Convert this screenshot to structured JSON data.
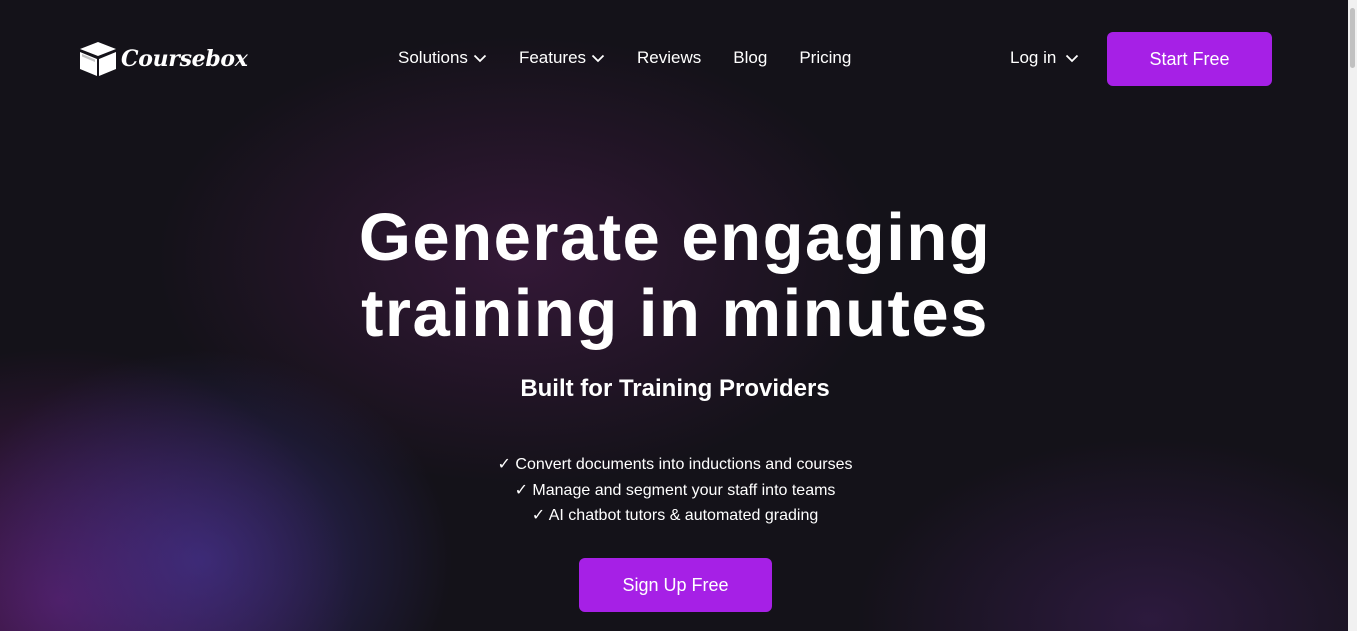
{
  "header": {
    "logo_text": "Coursebox",
    "nav": [
      {
        "label": "Solutions",
        "has_dropdown": true
      },
      {
        "label": "Features",
        "has_dropdown": true
      },
      {
        "label": "Reviews",
        "has_dropdown": false
      },
      {
        "label": "Blog",
        "has_dropdown": false
      },
      {
        "label": "Pricing",
        "has_dropdown": false
      }
    ],
    "login_label": "Log in",
    "start_button_label": "Start Free"
  },
  "hero": {
    "headline_line1": "Generate engaging",
    "headline_line2": "training in minutes",
    "subheadline": "Built for Training Providers",
    "features": [
      "✓ Convert documents into inductions and courses",
      "✓ Manage and segment your staff into teams",
      "✓ AI chatbot tutors & automated grading"
    ],
    "signup_button_label": "Sign Up Free"
  },
  "colors": {
    "background": "#141219",
    "accent": "#a620e6",
    "text": "#ffffff"
  },
  "icons": {
    "logo": "box-icon",
    "dropdown": "chevron-down-icon"
  }
}
